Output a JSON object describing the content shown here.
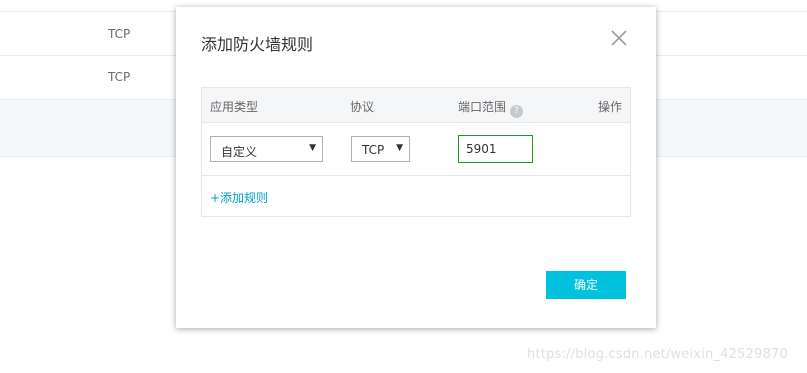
{
  "background": {
    "rows": [
      {
        "protocol": "TCP"
      },
      {
        "protocol": "TCP"
      }
    ]
  },
  "dialog": {
    "title": "添加防火墙规则",
    "table": {
      "headers": {
        "app_type": "应用类型",
        "protocol": "协议",
        "port_range": "端口范围",
        "actions": "操作"
      },
      "help_glyph": "?",
      "row": {
        "app_type": "自定义",
        "protocol": "TCP",
        "port": "5901"
      }
    },
    "add_rule_label": "+添加规则",
    "confirm_label": "确定"
  },
  "watermark": "https://blog.csdn.net/weixin_42529870",
  "colors": {
    "accent": "#00c1de",
    "link": "#00a2ca",
    "input_border_active": "#1f9a1f"
  },
  "icons": {
    "close": "close-icon",
    "help": "help-icon",
    "dropdown": "chevron-down-icon"
  }
}
